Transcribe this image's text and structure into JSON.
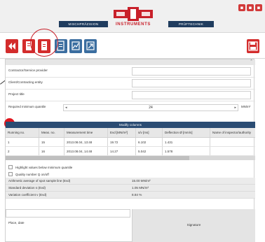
{
  "header": {
    "nav_left": "MISCHPRÄZISION",
    "nav_right": "PRÜFTECHNIK",
    "logo_brand": "INSTRUMENTS",
    "window_buttons": [
      "▪",
      "▪",
      "▪"
    ]
  },
  "toolbar": {
    "buttons": [
      {
        "icon": "back-double-arrow-icon",
        "color": "#d32c2c"
      },
      {
        "icon": "pdf-document-icon",
        "color": "#d32c2c"
      },
      {
        "icon": "document-icon",
        "color": "#d32c2c"
      },
      {
        "icon": "export-document-icon",
        "color": "#3b6ea0"
      },
      {
        "icon": "chart-icon",
        "color": "#3b6ea0"
      },
      {
        "icon": "share-icon",
        "color": "#3b6ea0"
      }
    ],
    "save_icon": "floppy-disk-icon"
  },
  "form": {
    "contractor_label": "Contractor/Service provider",
    "client_label": "Client/Contracting entity",
    "project_label": "Project title",
    "contractor_value": "",
    "client_value": "",
    "project_value": ""
  },
  "quantile": {
    "label": "Required minimum quantile",
    "value": "24",
    "unit": "MN/m²"
  },
  "modify_label": "Modify columns",
  "table": {
    "headers": [
      "Running no.",
      "Meas. no.",
      "Measurement time",
      "Evd [MN/m²]",
      "s/v [ms]",
      "Deflection Ø [mm/s]",
      "Name of inspector/authority"
    ],
    "rows": [
      [
        "1",
        "15",
        "2013.08.04, 13:48",
        "19.72",
        "6.102",
        "1.431",
        ""
      ],
      [
        "2",
        "16",
        "2013.08.04, 14:48",
        "14.27",
        "5.042",
        "1.578",
        ""
      ]
    ]
  },
  "options": {
    "highlight_label": "Highlight values below minimum quantile",
    "quality_label": "Quality number Q on/off"
  },
  "stats": [
    {
      "label": "Arithmetic average of spot sample line (Evd)",
      "value": "15.00 MN/m²"
    },
    {
      "label": "Standard deviation s (Evd)",
      "value": "1.05 MN/m²"
    },
    {
      "label": "Variation coefficient v (Evd)",
      "value": "8.84 %"
    }
  ],
  "signature": {
    "place_label": "Place, date",
    "signature_label": "Signature"
  },
  "colors": {
    "brand_red": "#c8202a",
    "nav_blue": "#1f3c5e",
    "header_blue": "#2b4c73",
    "highlight_dot": "#e0161e"
  }
}
